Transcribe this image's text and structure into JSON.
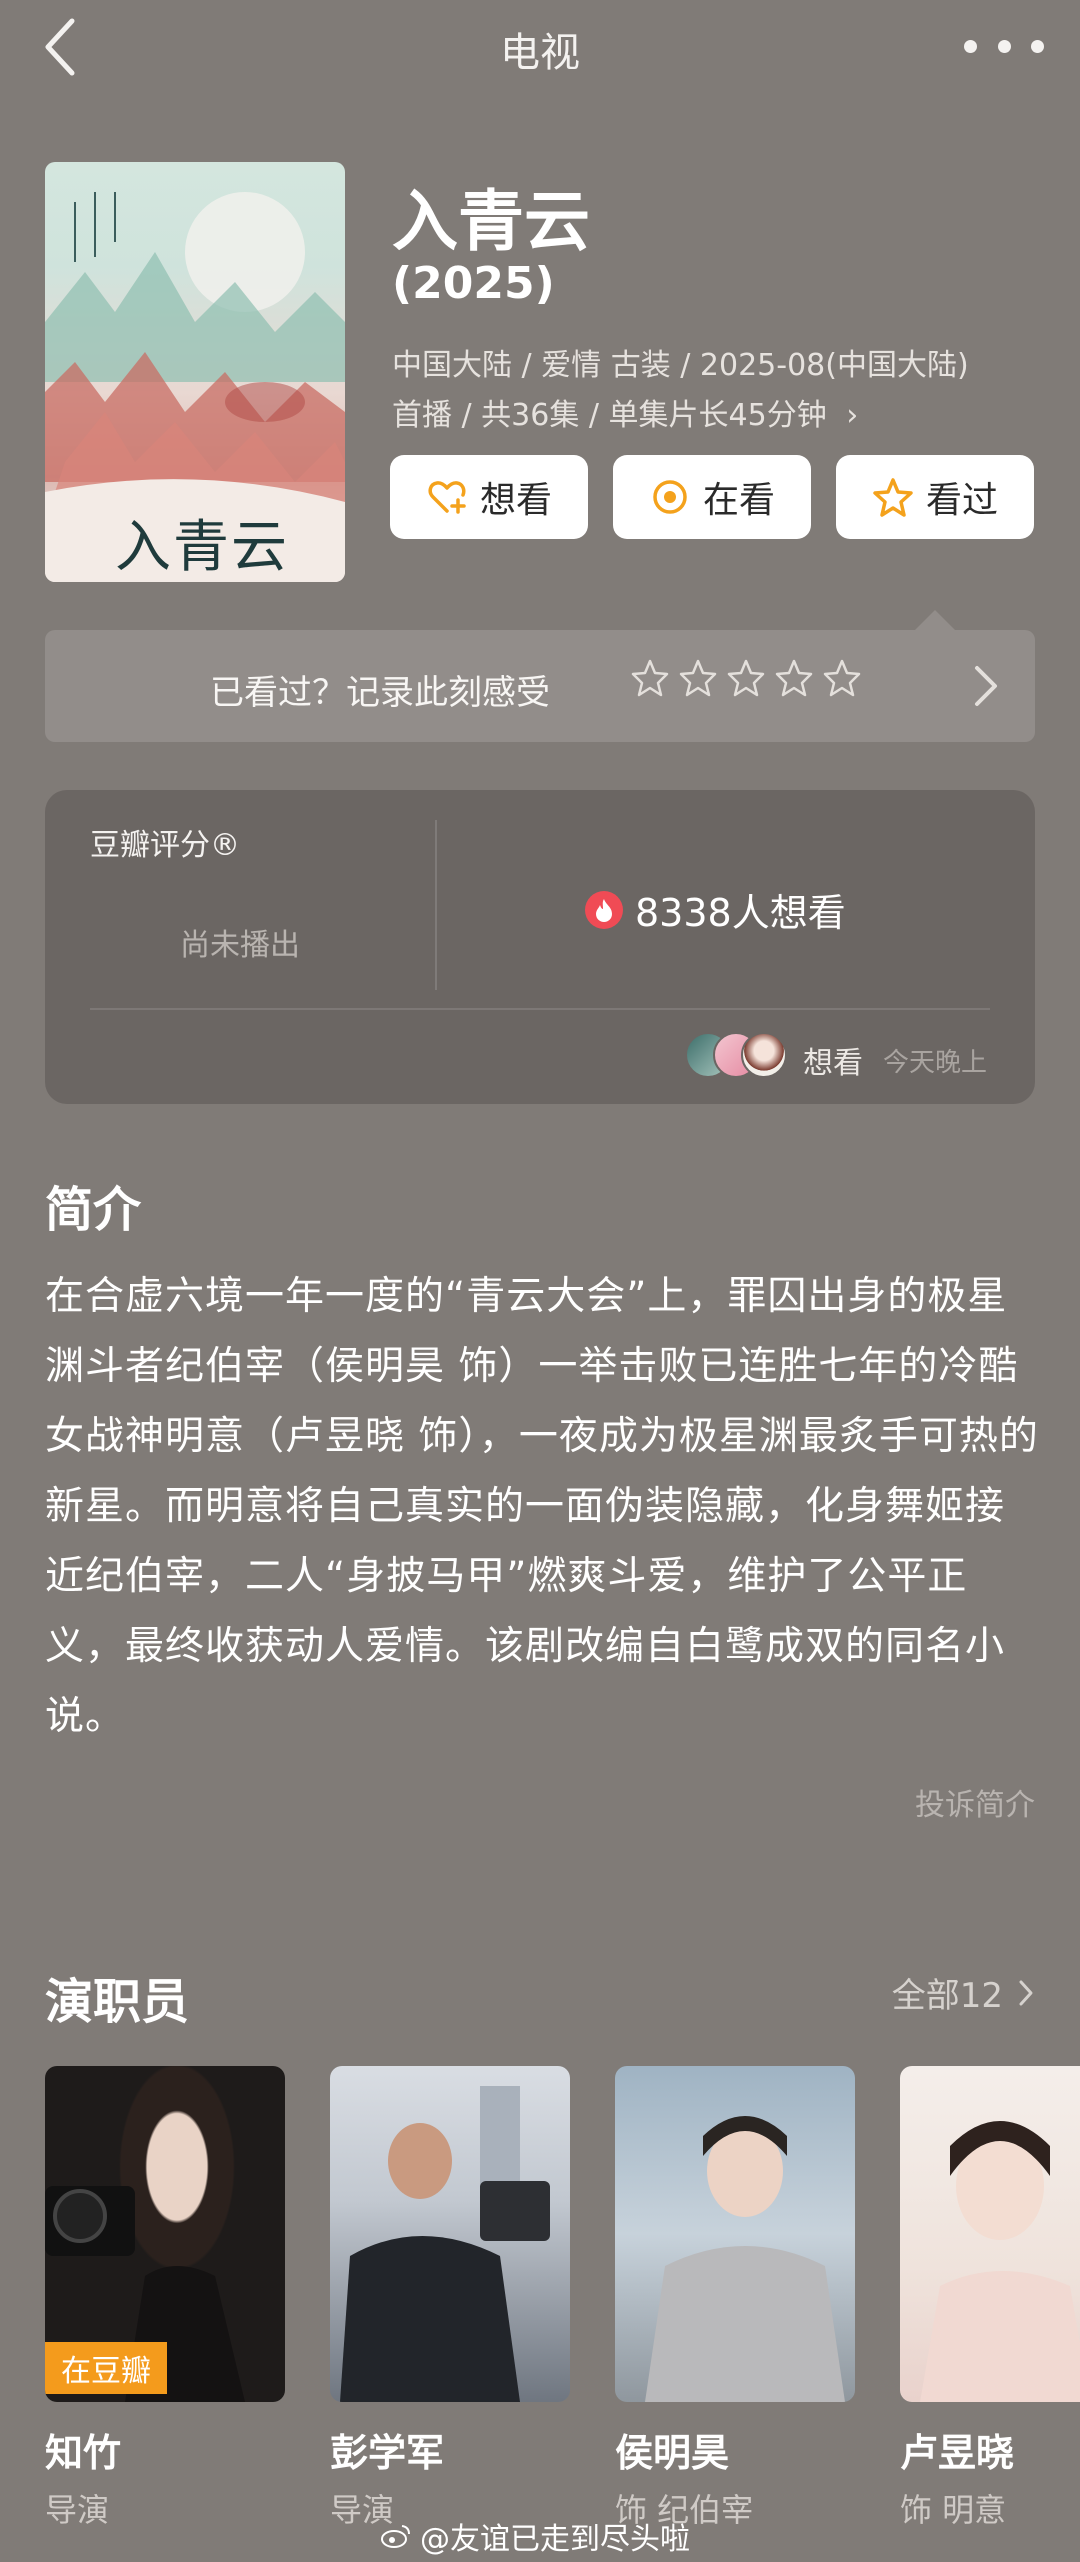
{
  "header": {
    "title": "电视"
  },
  "poster": {
    "title_text": "入青云"
  },
  "show": {
    "title": "入青云",
    "year": "(2025)",
    "meta_line1": "中国大陆 / 爱情 古装 / 2025-08(中国大陆)",
    "meta_line2": "首播 / 共36集 / 单集片长45分钟",
    "meta_more": "›"
  },
  "actions": [
    {
      "label": "想看",
      "icon": "heart-plus-icon"
    },
    {
      "label": "在看",
      "icon": "target-icon"
    },
    {
      "label": "看过",
      "icon": "star-icon"
    }
  ],
  "rate_bar": {
    "prompt": "已看过？记录此刻感受",
    "stars": 5
  },
  "score": {
    "label": "豆瓣评分®",
    "status": "尚未播出",
    "want_count": "8338人想看",
    "friend_status": "想看",
    "friend_time": "今天晚上"
  },
  "intro": {
    "heading": "简介",
    "body": "在合虚六境一年一度的“青云大会”上，罪囚出身的极星渊斗者纪伯宰（侯明昊 饰）一举击败已连胜七年的冷酷女战神明意（卢昱晓 饰），一夜成为极星渊最炙手可热的新星。而明意将自己真实的一面伪装隐藏，化身舞姬接近纪伯宰，二人“身披马甲”燃爽斗爱，维护了公平正义，最终收获动人爱情。该剧改编自白鹭成双的同名小说。",
    "report": "投诉简介"
  },
  "cast": {
    "heading": "演职员",
    "all_label": "全部12",
    "members": [
      {
        "name": "知竹",
        "role": "导演",
        "tag": "在豆瓣"
      },
      {
        "name": "彭学军",
        "role": "导演"
      },
      {
        "name": "侯明昊",
        "role": "饰 纪伯宰"
      },
      {
        "name": "卢昱晓",
        "role": "饰 明意"
      }
    ]
  },
  "watermark": "@友谊已走到尽头啦",
  "colors": {
    "background": "#807b77",
    "card": "#6b6663",
    "accent": "#f4a21c",
    "flame": "#f04b55"
  }
}
